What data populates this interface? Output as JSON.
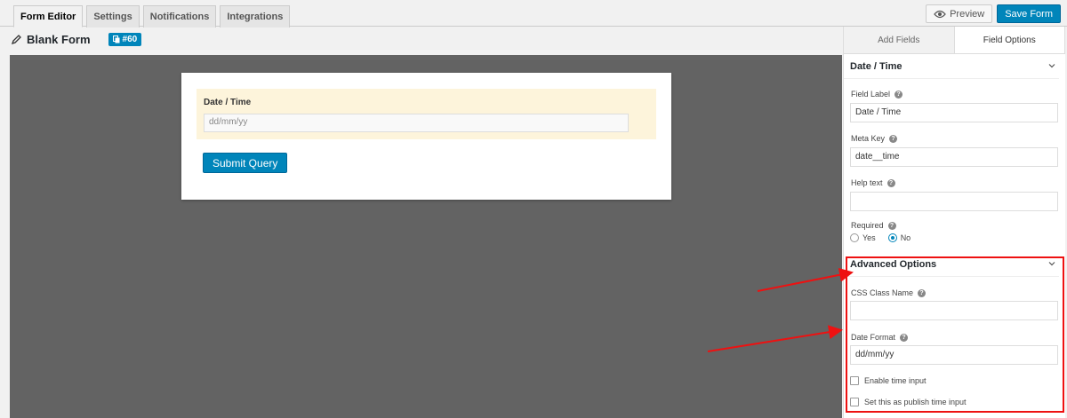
{
  "tabs": [
    {
      "label": "Form Editor",
      "active": true
    },
    {
      "label": "Settings",
      "active": false
    },
    {
      "label": "Notifications",
      "active": false
    },
    {
      "label": "Integrations",
      "active": false
    }
  ],
  "actions": {
    "preview_label": "Preview",
    "save_label": "Save Form"
  },
  "form": {
    "title": "Blank Form",
    "id": "#60"
  },
  "canvas": {
    "field_label": "Date / Time",
    "field_placeholder": "dd/mm/yy",
    "submit_label": "Submit Query"
  },
  "panel": {
    "tabs": [
      "Add Fields",
      "Field Options"
    ],
    "active_tab": "Field Options",
    "section_title": "Date / Time",
    "field_label_label": "Field Label",
    "field_label_value": "Date / Time",
    "meta_key_label": "Meta Key",
    "meta_key_value": "date__time",
    "help_text_label": "Help text",
    "help_text_value": "",
    "required_label": "Required",
    "required_options": [
      "Yes",
      "No"
    ],
    "required_selected": "No",
    "advanced_title": "Advanced Options",
    "css_class_label": "CSS Class Name",
    "css_class_value": "",
    "date_format_label": "Date Format",
    "date_format_value": "dd/mm/yy",
    "enable_time_label": "Enable time input",
    "publish_time_label": "Set this as publish time input"
  },
  "colors": {
    "accent": "#0085ba",
    "highlight": "#e11111",
    "canvas": "#636363",
    "field_bg": "#fdf4db"
  }
}
